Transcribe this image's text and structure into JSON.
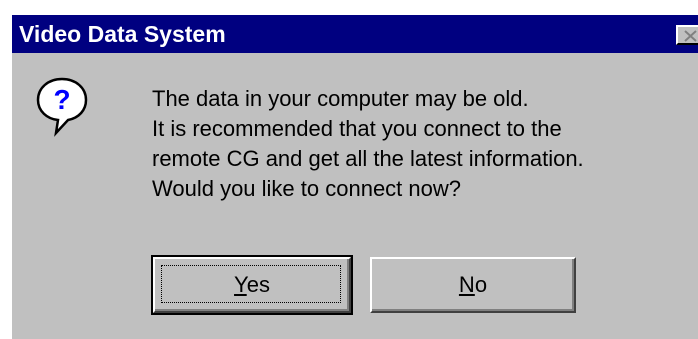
{
  "window": {
    "title": "Video Data System"
  },
  "titlebar": {
    "close_icon": "close-icon"
  },
  "icon": {
    "name": "question-icon",
    "glyph": "?",
    "color": "#0000ff"
  },
  "message": {
    "lines": [
      "The data in your computer may be old.",
      "It is recommended that you connect to the",
      "remote CG and get all the latest information.",
      "Would you like to connect now?"
    ]
  },
  "buttons": {
    "yes": {
      "accel": "Y",
      "rest": "es"
    },
    "no": {
      "accel": "N",
      "rest": "o"
    }
  },
  "colors": {
    "titlebar": "#000080",
    "dialog_face": "#c0c0c0",
    "title_text": "#ffffff"
  }
}
